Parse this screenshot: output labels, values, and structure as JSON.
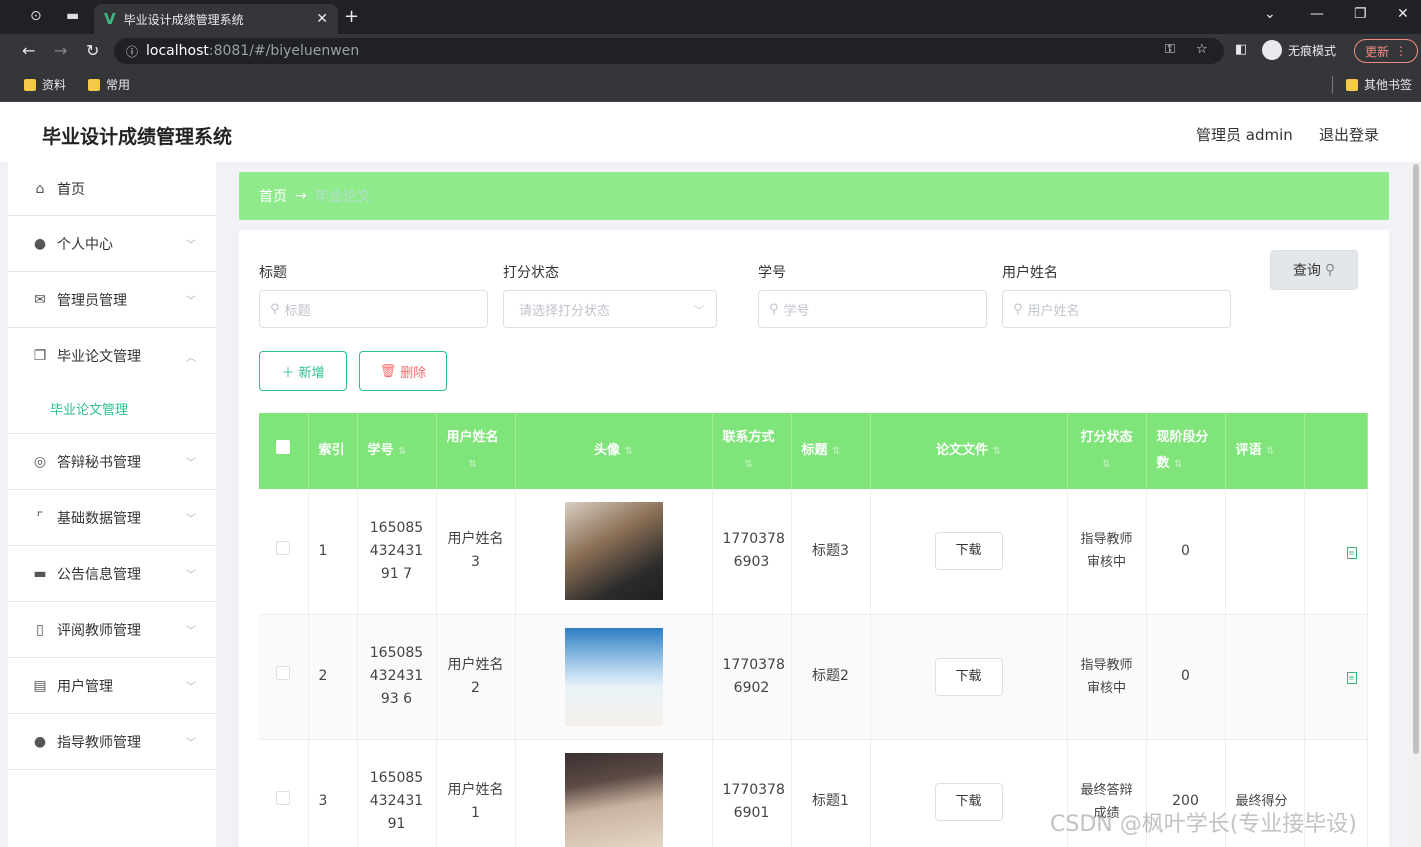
{
  "browser": {
    "tab_title": "毕业设计成绩管理系统",
    "url_host": "localhost",
    "url_path": ":8081/#/biyeluenwen",
    "incognito_label": "无痕模式",
    "update_label": "更新",
    "bookmarks": [
      "资料",
      "常用"
    ],
    "other_bookmarks": "其他书签"
  },
  "header": {
    "title": "毕业设计成绩管理系统",
    "user": "管理员 admin",
    "logout": "退出登录"
  },
  "sidebar": {
    "items": [
      {
        "label": "首页",
        "icon": "home-icon"
      },
      {
        "label": "个人中心",
        "icon": "user-icon"
      },
      {
        "label": "管理员管理",
        "icon": "mail-icon"
      },
      {
        "label": "毕业论文管理",
        "icon": "copy-icon"
      },
      {
        "label": "答辩秘书管理",
        "icon": "target-icon"
      },
      {
        "label": "基础数据管理",
        "icon": "crop-icon"
      },
      {
        "label": "公告信息管理",
        "icon": "monitor-icon"
      },
      {
        "label": "评阅教师管理",
        "icon": "phone-icon"
      },
      {
        "label": "用户管理",
        "icon": "doc-icon"
      },
      {
        "label": "指导教师管理",
        "icon": "bulb-icon"
      }
    ],
    "active_sub": "毕业论文管理"
  },
  "breadcrumb": {
    "home": "首页",
    "arrow": "→",
    "current": "毕业论文"
  },
  "filters": {
    "title_label": "标题",
    "title_placeholder": "标题",
    "status_label": "打分状态",
    "status_placeholder": "请选择打分状态",
    "sno_label": "学号",
    "sno_placeholder": "学号",
    "username_label": "用户姓名",
    "username_placeholder": "用户姓名",
    "query_button": "查询"
  },
  "actions": {
    "add": "新增",
    "delete": "删除"
  },
  "table": {
    "headers": {
      "index": "索引",
      "sno": "学号",
      "username": "用户姓名",
      "avatar": "头像",
      "contact": "联系方式",
      "title": "标题",
      "file": "论文文件",
      "status": "打分状态",
      "score": "现阶段分数",
      "comment": "评语"
    },
    "rows": [
      {
        "index": "1",
        "sno": "16508543243191\n7",
        "username": "用户姓名\n3",
        "contact": "1770378\n6903",
        "title": "标题3",
        "download": "下载",
        "status": "指导教师\n审核中",
        "score": "0",
        "comment": ""
      },
      {
        "index": "2",
        "sno": "16508543243193\n6",
        "username": "用户姓名\n2",
        "contact": "1770378\n6902",
        "title": "标题2",
        "download": "下载",
        "status": "指导教师\n审核中",
        "score": "0",
        "comment": ""
      },
      {
        "index": "3",
        "sno": "16508543243191",
        "username": "用户姓名\n1",
        "contact": "1770378\n6901",
        "title": "标题1",
        "download": "下载",
        "status": "最终答辩\n成绩",
        "score": "200",
        "comment": "最终得分"
      }
    ]
  },
  "watermark": "CSDN @枫叶学长(专业接毕设)"
}
